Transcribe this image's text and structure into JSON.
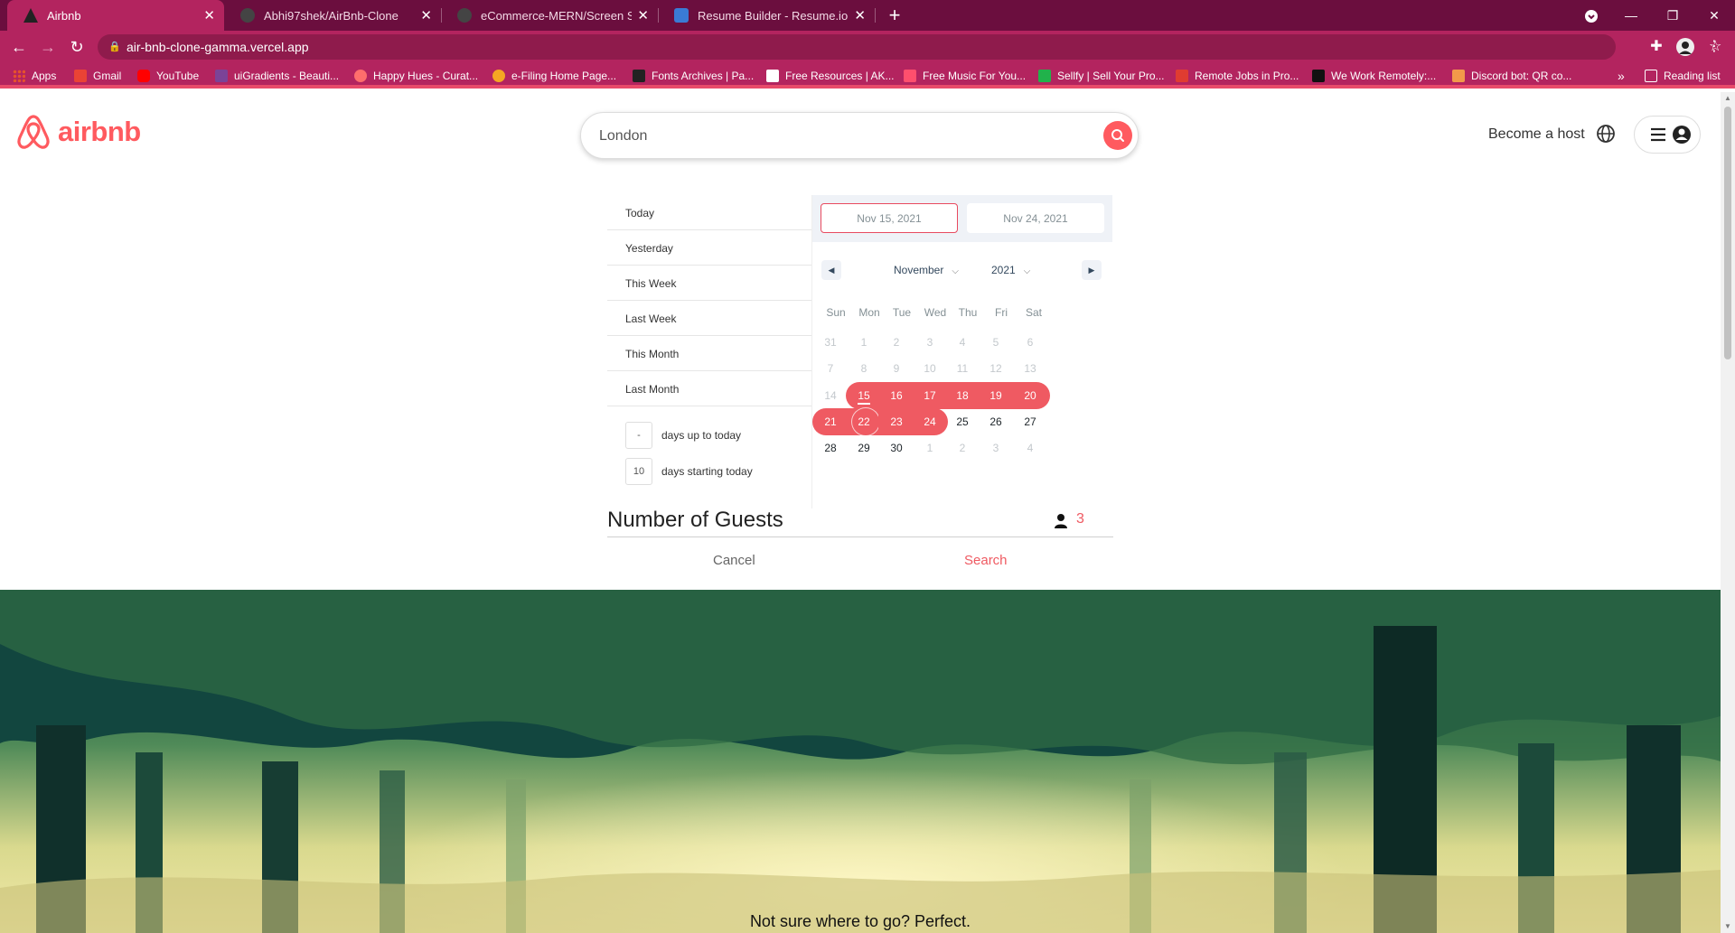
{
  "browser": {
    "tabs": [
      {
        "title": "Airbnb",
        "active": true,
        "favicon": "airbnb-favicon"
      },
      {
        "title": "Abhi97shek/AirBnb-Clone",
        "active": false,
        "favicon": "github-favicon"
      },
      {
        "title": "eCommerce-MERN/Screen Shot",
        "active": false,
        "favicon": "github-favicon"
      },
      {
        "title": "Resume Builder - Resume.io",
        "active": false,
        "favicon": "resume-favicon"
      }
    ],
    "url": "air-bnb-clone-gamma.vercel.app",
    "bookmarks": [
      {
        "label": "Apps",
        "color": "#e6522c"
      },
      {
        "label": "Gmail",
        "color": "#ea4335"
      },
      {
        "label": "YouTube",
        "color": "#ff0000"
      },
      {
        "label": "uiGradients - Beauti...",
        "color": "#7b4397"
      },
      {
        "label": "Happy Hues - Curat...",
        "color": "#ff6e6c"
      },
      {
        "label": "e-Filing Home Page...",
        "color": "#f5a623"
      },
      {
        "label": "Fonts Archives | Pa...",
        "color": "#222222"
      },
      {
        "label": "Free Resources | AK...",
        "color": "#ffffff"
      },
      {
        "label": "Free Music For You...",
        "color": "#ff4f6d"
      },
      {
        "label": "Sellfy | Sell Your Pro...",
        "color": "#21b24b"
      },
      {
        "label": "Remote Jobs in Pro...",
        "color": "#e03c31"
      },
      {
        "label": "We Work Remotely:...",
        "color": "#111111"
      },
      {
        "label": "Discord bot: QR co...",
        "color": "#f2994a"
      }
    ],
    "overflow": "»",
    "reading_list": "Reading list"
  },
  "header": {
    "logo_text": "airbnb",
    "search_value": "London",
    "become_host": "Become a host"
  },
  "date_picker": {
    "static_ranges": [
      "Today",
      "Yesterday",
      "This Week",
      "Last Week",
      "This Month",
      "Last Month"
    ],
    "input_ranges": [
      {
        "value": "-",
        "label": "days up to today"
      },
      {
        "value": "10",
        "label": "days starting today"
      }
    ],
    "start_date": "Nov 15, 2021",
    "end_date": "Nov 24, 2021",
    "month": "November",
    "year": "2021",
    "weekdays": [
      "Sun",
      "Mon",
      "Tue",
      "Wed",
      "Thu",
      "Fri",
      "Sat"
    ],
    "weeks": [
      [
        {
          "d": "31",
          "p": true
        },
        {
          "d": "1",
          "p": true
        },
        {
          "d": "2",
          "p": true
        },
        {
          "d": "3",
          "p": true
        },
        {
          "d": "4",
          "p": true
        },
        {
          "d": "5",
          "p": true
        },
        {
          "d": "6",
          "p": true
        }
      ],
      [
        {
          "d": "7",
          "p": true
        },
        {
          "d": "8",
          "p": true
        },
        {
          "d": "9",
          "p": true
        },
        {
          "d": "10",
          "p": true
        },
        {
          "d": "11",
          "p": true
        },
        {
          "d": "12",
          "p": true
        },
        {
          "d": "13",
          "p": true
        }
      ],
      [
        {
          "d": "14",
          "p": true
        },
        {
          "d": "15",
          "s": "start",
          "today": true
        },
        {
          "d": "16",
          "s": "mid"
        },
        {
          "d": "17",
          "s": "mid"
        },
        {
          "d": "18",
          "s": "mid"
        },
        {
          "d": "19",
          "s": "mid"
        },
        {
          "d": "20",
          "s": "end"
        }
      ],
      [
        {
          "d": "21",
          "s": "start"
        },
        {
          "d": "22",
          "s": "mid",
          "ring": true
        },
        {
          "d": "23",
          "s": "mid"
        },
        {
          "d": "24",
          "s": "end"
        },
        {
          "d": "25"
        },
        {
          "d": "26"
        },
        {
          "d": "27"
        }
      ],
      [
        {
          "d": "28"
        },
        {
          "d": "29"
        },
        {
          "d": "30"
        },
        {
          "d": "1",
          "p": true
        },
        {
          "d": "2",
          "p": true
        },
        {
          "d": "3",
          "p": true
        },
        {
          "d": "4",
          "p": true
        }
      ]
    ],
    "accent_color": "#ef5a62"
  },
  "guests": {
    "label": "Number of Guests",
    "count": "3"
  },
  "actions": {
    "cancel": "Cancel",
    "search": "Search"
  },
  "hero": {
    "text": "Not sure where to go? Perfect."
  },
  "colors": {
    "brand": "#ff5a5f",
    "tab_bar": "#6b0e3e",
    "toolbar": "#b3245f"
  }
}
